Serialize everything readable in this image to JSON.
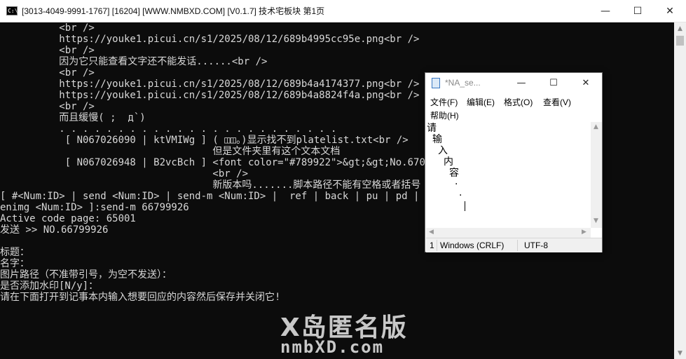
{
  "console_window": {
    "title": "[3013-4049-9991-1767] [16204] [WWW.NMBXD.COM] [V0.1.7]  技术宅板块     第1页",
    "icon": "cmd-icon",
    "icon_text": "C:\\",
    "minimize": "—",
    "maximize": "☐",
    "close": "✕"
  },
  "console_lines": [
    "          <br />",
    "          https://youke1.picui.cn/s1/2025/08/12/689b4995cc95e.png<br />",
    "          <br />",
    "          因为它只能查看文字还不能发话......<br />",
    "          <br />",
    "          https://youke1.picui.cn/s1/2025/08/12/689b4a4174377.png<br />",
    "          https://youke1.picui.cn/s1/2025/08/12/689b4a8824f4a.png<br />",
    "          <br />",
    "          而且缓慢( ;  д`)",
    "          . . . . . . . . . . . . . . . . . . . . . . . .",
    "           [ N067026090 | ktVMIWg ] ( ◫◫。)显示找不到platelist.txt<br />",
    "                                    但是文件夹里有这个文本文档",
    "           [ N067026948 | B2vcBch ] <font color=\"#789922\">&gt;&gt;No.67026090",
    "                                    <br />",
    "                                    新版本吗.......脚本路径不能有空格或者括号",
    "[ #<Num:ID> | send <Num:ID> | send-m <Num:ID> |  ref | back | pu | pd | page <Num> | openweb | op",
    "enimg <Num:ID> ]:send-m 66799926",
    "Active code page: 65001",
    "发送 >> NO.66799926",
    "",
    "标题：",
    "名字：",
    "图片路径（不准带引号，为空不发送）：",
    "是否添加水印[N/y]：",
    "请在下面打开到记事本内输入想要回应的内容然后保存并关闭它!"
  ],
  "watermark": {
    "line1": "X岛匿名版",
    "line2": "nmbXD.com"
  },
  "notepad": {
    "title": "*NA_se...",
    "menu": [
      "文件(F)",
      "编辑(E)",
      "格式(O)",
      "查看(V)",
      "帮助(H)"
    ],
    "content_lines": [
      "请",
      "输",
      "入",
      "内",
      "容",
      "·",
      "·"
    ],
    "status": {
      "position": "1",
      "line_ending": "Windows (CRLF)",
      "encoding": "UTF-8"
    },
    "minimize": "—",
    "maximize": "☐",
    "close": "✕"
  }
}
